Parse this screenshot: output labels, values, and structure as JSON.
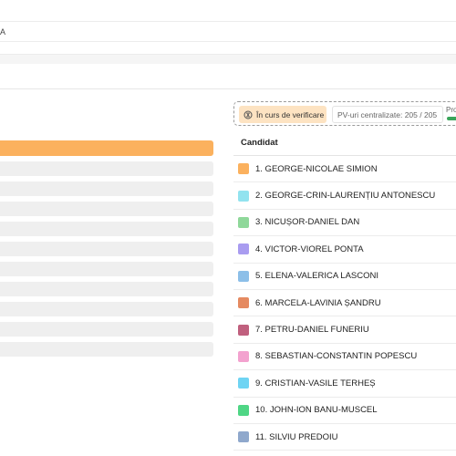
{
  "header": {
    "row2_text": "A"
  },
  "filters": {
    "status_label": "În curs de verificare",
    "pv_label": "PV-uri centralizate: 205 / 205",
    "progress_label": "Pro",
    "progress_value": 1.0
  },
  "table": {
    "column_header": "Candidat",
    "candidates": [
      {
        "label": "1. GEORGE-NICOLAE SIMION",
        "color": "#fbb15e"
      },
      {
        "label": "2. GEORGE-CRIN-LAURENȚIU ANTONESCU",
        "color": "#92e3ef"
      },
      {
        "label": "3. NICUȘOR-DANIEL DAN",
        "color": "#8fd89a"
      },
      {
        "label": "4. VICTOR-VIOREL PONTA",
        "color": "#a99cf0"
      },
      {
        "label": "5. ELENA-VALERICA LASCONI",
        "color": "#8cbfe8"
      },
      {
        "label": "6. MARCELA-LAVINIA ȘANDRU",
        "color": "#e58a61"
      },
      {
        "label": "7. PETRU-DANIEL FUNERIU",
        "color": "#c0607e"
      },
      {
        "label": "8. SEBASTIAN-CONSTANTIN POPESCU",
        "color": "#f3a2cf"
      },
      {
        "label": "9. CRISTIAN-VASILE TERHEȘ",
        "color": "#6fd4f3"
      },
      {
        "label": "10. JOHN-ION BANU-MUSCEL",
        "color": "#4fd685"
      },
      {
        "label": "11. SILVIU PREDOIU",
        "color": "#8fa8cc"
      }
    ]
  }
}
